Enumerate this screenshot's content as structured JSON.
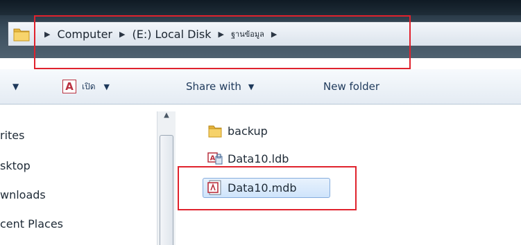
{
  "address_bar": {
    "crumbs": [
      {
        "label": "Computer"
      },
      {
        "label": "(E:) Local Disk"
      },
      {
        "label": "ฐานข้อมูล"
      }
    ]
  },
  "command_bar": {
    "open_label": "เปิด",
    "share_label": "Share with",
    "new_folder_label": "New folder"
  },
  "nav_pane": {
    "items": [
      "rites",
      "sktop",
      "wnloads",
      "cent Places"
    ]
  },
  "files": [
    {
      "name": "backup",
      "icon": "folder-icon"
    },
    {
      "name": "Data10.ldb",
      "icon": "access-lock-file-icon"
    },
    {
      "name": "Data10.mdb",
      "icon": "access-database-icon",
      "selected": true
    }
  ],
  "colors": {
    "highlight_box": "#e0222d",
    "selection_fill": "#cfe4fb",
    "address_bar_dark": "#3a4d5c"
  }
}
